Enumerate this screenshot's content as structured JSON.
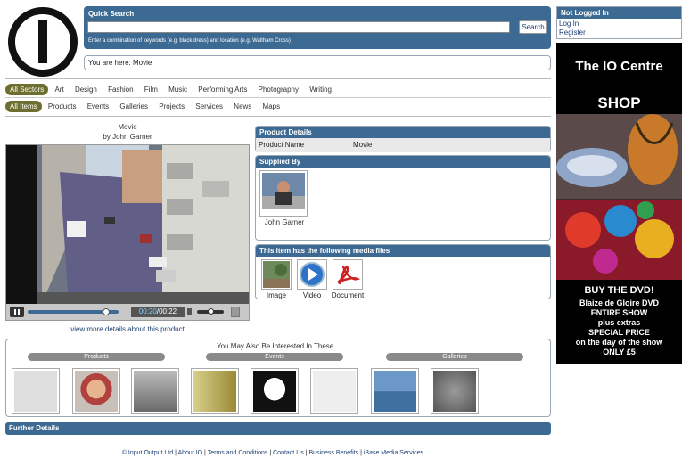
{
  "search": {
    "title": "Quick Search",
    "placeholder": "",
    "button": "Search",
    "hint": "Enter a combination of keywords (e.g. black dress) and location (e.g. Waltham Cross)"
  },
  "breadcrumb": "You are here: Movie",
  "sectors": [
    "All Sectors",
    "Art",
    "Design",
    "Fashion",
    "Film",
    "Music",
    "Performing Arts",
    "Photography",
    "Writing"
  ],
  "item_types": [
    "All Items",
    "Products",
    "Events",
    "Galleries",
    "Projects",
    "Services",
    "News",
    "Maps"
  ],
  "product": {
    "title": "Movie",
    "byline": "by John Garner",
    "time_current": "00:20",
    "time_total": "00:22",
    "more_link": "view more details about this product"
  },
  "details": {
    "header": "Product Details",
    "label": "Product Name",
    "value": "Movie"
  },
  "supplier": {
    "header": "Supplied By",
    "name": "John Garner"
  },
  "media": {
    "header": "This item has the following media files",
    "items": [
      "Image",
      "Video",
      "Document"
    ]
  },
  "related": {
    "title": "You May Also Be Interested In These...",
    "groups": [
      "Products",
      "Events",
      "Galleries"
    ]
  },
  "further": "Further Details",
  "login": {
    "status": "Not Logged In",
    "login": "Log In",
    "register": "Register"
  },
  "ad": {
    "title": "The IO Centre",
    "shop": "SHOP",
    "line1": "BUY THE DVD!",
    "line2": "Blaize de Gloire DVD",
    "line3": "ENTIRE SHOW",
    "line4": "plus extras",
    "line5": "SPECIAL PRICE",
    "line6": "on the day of the show",
    "line7": "ONLY £5"
  },
  "footer": [
    "© Input Output Ltd",
    "About IO",
    "Terms and Conditions",
    "Contact Us",
    "Business Benefits",
    "iBase Media Services"
  ],
  "colors": {
    "bar": "#3d6a93",
    "active_pill": "#6e6e30"
  }
}
